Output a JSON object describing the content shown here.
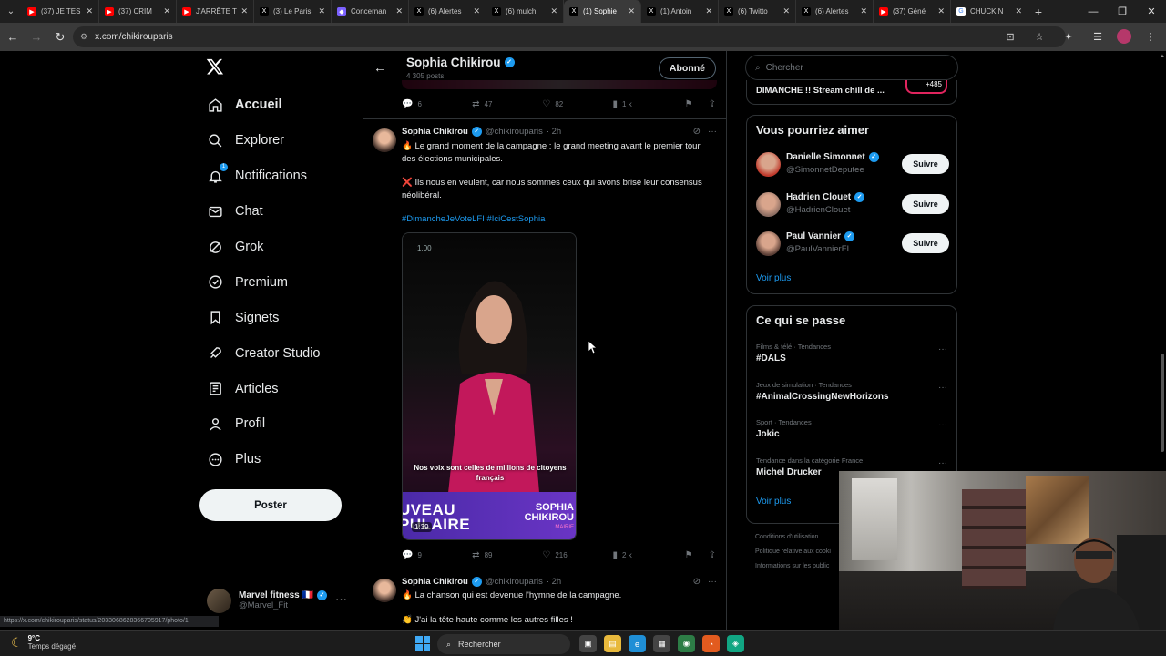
{
  "browser": {
    "tabs": [
      {
        "label": "(37) JE TES",
        "fav_color": "#ff0000",
        "fav": "▶"
      },
      {
        "label": "(37) CRIM",
        "fav_color": "#ff0000",
        "fav": "▶"
      },
      {
        "label": "J'ARRÊTE T",
        "fav_color": "#ff0000",
        "fav": "▶"
      },
      {
        "label": "(3) Le Paris",
        "fav_color": "#000000",
        "fav": "X"
      },
      {
        "label": "Concernan",
        "fav_color": "#7b61ff",
        "fav": "◆"
      },
      {
        "label": "(6) Alertes",
        "fav_color": "#000000",
        "fav": "X"
      },
      {
        "label": "(6) mulch",
        "fav_color": "#000000",
        "fav": "X"
      },
      {
        "label": "(1) Sophie",
        "fav_color": "#000000",
        "fav": "X"
      },
      {
        "label": "(1) Antoin",
        "fav_color": "#000000",
        "fav": "X"
      },
      {
        "label": "(6) Twitto",
        "fav_color": "#000000",
        "fav": "X"
      },
      {
        "label": "(6) Alertes",
        "fav_color": "#000000",
        "fav": "X"
      },
      {
        "label": "(37) Géné",
        "fav_color": "#ff0000",
        "fav": "▶"
      },
      {
        "label": "CHUCK N",
        "fav_color": "#ffffff",
        "fav": "G"
      }
    ],
    "active_tab_index": 7,
    "url": "x.com/chikirouparis",
    "status_url": "https://x.com/chikirouparis/status/2033068628366705917/photo/1"
  },
  "nav": {
    "logo": "X",
    "items": [
      {
        "label": "Accueil",
        "icon": "home-icon"
      },
      {
        "label": "Explorer",
        "icon": "search-icon"
      },
      {
        "label": "Notifications",
        "icon": "bell-icon",
        "badge": "1"
      },
      {
        "label": "Chat",
        "icon": "mail-icon"
      },
      {
        "label": "Grok",
        "icon": "grok-icon"
      },
      {
        "label": "Premium",
        "icon": "premium-icon"
      },
      {
        "label": "Signets",
        "icon": "bookmark-icon"
      },
      {
        "label": "Creator Studio",
        "icon": "rocket-icon"
      },
      {
        "label": "Articles",
        "icon": "article-icon"
      },
      {
        "label": "Profil",
        "icon": "person-icon"
      },
      {
        "label": "Plus",
        "icon": "more-circle-icon"
      }
    ],
    "post_button": "Poster",
    "account": {
      "name": "Marvel fitness 🇫🇷",
      "handle": "@Marvel_Fit"
    }
  },
  "profile_header": {
    "name": "Sophia Chikirou",
    "posts": "4 305 posts",
    "follow_state": "Abonné"
  },
  "previous_tweet_actions": {
    "replies": "6",
    "reposts": "47",
    "likes": "82",
    "views": "1 k"
  },
  "tweets": [
    {
      "name": "Sophia Chikirou",
      "handle": "@chikirouparis",
      "time": "· 2h",
      "line1": "🔥 Le grand moment de la campagne : le grand meeting avant le premier tour des élections municipales.",
      "line2": "❌ Ils nous en veulent, car nous sommes ceux qui avons brisé leur consensus néolibéral.",
      "tags": "#DimancheJeVoteLFI #IciCestSophia",
      "video": {
        "speed": "1.00",
        "caption": "Nos voix sont celles de millions de citoyens français",
        "banner_left": "UVEAU\nPULAIRE",
        "banner_right": "SOPHIA\nCHIKIROU",
        "banner_small": "MAIRIE",
        "duration": "1:39"
      },
      "actions": {
        "replies": "9",
        "reposts": "89",
        "likes": "216",
        "views": "2 k"
      }
    },
    {
      "name": "Sophia Chikirou",
      "handle": "@chikirouparis",
      "time": "· 2h",
      "line1": "🔥 La chanson qui est devenue l'hymne de la campagne.",
      "line2": "👏 J'ai la tête haute comme les autres filles !"
    }
  ],
  "right": {
    "search_placeholder": "Chercher",
    "live": {
      "title": "DIMANCHE !! Stream chill de ...",
      "count": "+485"
    },
    "suggestions_title": "Vous pourriez aimer",
    "suggestions": [
      {
        "name": "Danielle Simonnet",
        "handle": "@SimonnetDeputee",
        "button": "Suivre",
        "avatar_color": "#c0392b"
      },
      {
        "name": "Hadrien Clouet",
        "handle": "@HadrienClouet",
        "button": "Suivre",
        "avatar_color": "#8d6e63"
      },
      {
        "name": "Paul Vannier",
        "handle": "@PaulVannierFI",
        "button": "Suivre",
        "avatar_color": "#5d4037"
      }
    ],
    "see_more": "Voir plus",
    "trends_title": "Ce qui se passe",
    "trends": [
      {
        "category": "Films & télé · Tendances",
        "name": "#DALS"
      },
      {
        "category": "Jeux de simulation · Tendances",
        "name": "#AnimalCrossingNewHorizons"
      },
      {
        "category": "Sport · Tendances",
        "name": "Jokic"
      },
      {
        "category": "Tendance dans la catégorie France",
        "name": "Michel Drucker"
      }
    ],
    "trends_see_more": "Voir plus",
    "footer": [
      "Conditions d'utilisation",
      "Politique relative aux cooki",
      "Informations sur les public"
    ]
  },
  "taskbar": {
    "temp": "9°C",
    "weather": "Temps dégagé",
    "search": "Rechercher"
  }
}
